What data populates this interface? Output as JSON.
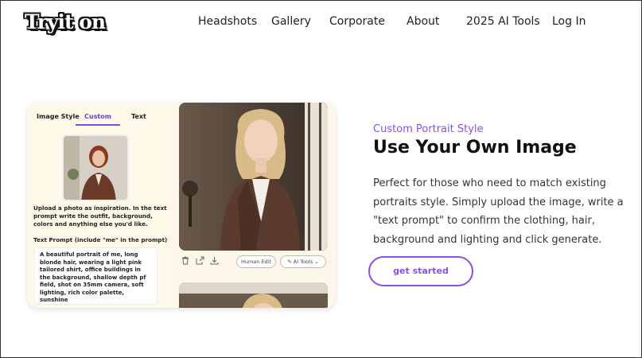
{
  "nav": {
    "logo": "Tryit on",
    "links": [
      "Headshots",
      "Gallery",
      "Corporate",
      "About",
      "2025 AI Tools",
      "Log In"
    ]
  },
  "card": {
    "tabs": [
      "Image Style",
      "Custom",
      "Text"
    ],
    "active_tab": "Custom",
    "instructions": "Upload a photo as inspiration. In the text prompt write the outfit, background, colors and anything else you'd like.",
    "prompt_label": "Text Prompt (include \"me\" in the prompt)",
    "prompt_value": "A beautiful portrait of me, long blonde hair, wearing a light pink tailored shirt, office buildings in the background, shallow depth pf field, shot on 35mm camera, soft lighting, rich color palette, sunshine",
    "tools": {
      "delete_icon": "trash-icon",
      "share_icon": "share-icon",
      "download_icon": "download-icon",
      "human_edit": "Human Edit",
      "ai_tools": "AI Tools"
    }
  },
  "hero": {
    "eyebrow": "Custom Portrait Style",
    "headline": "Use Your Own Image",
    "body": "Perfect for those who need to match existing portraits style. Simply upload the image, write a \"text prompt\" to confirm the clothing, hair, background and lighting and click generate.",
    "cta": "get started"
  },
  "colors": {
    "accent": "#8a4fe8",
    "panel_bg": "#fef8e8"
  }
}
